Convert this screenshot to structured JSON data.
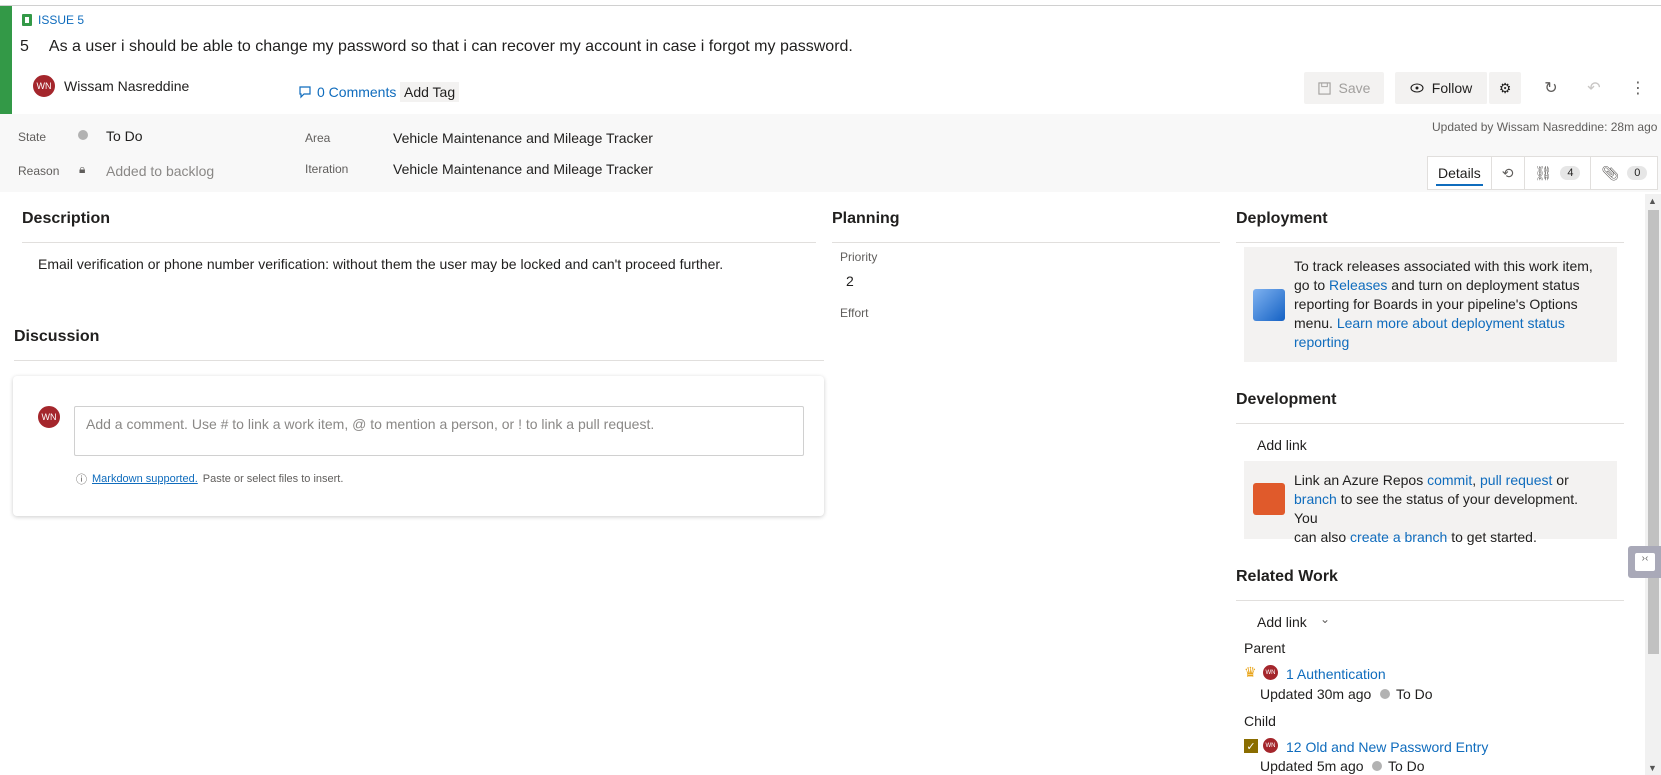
{
  "workitem": {
    "type_label": "ISSUE 5",
    "id": "5",
    "title": "As a user i should be able to change my password so that i can recover my account in case i forgot my password.",
    "author": "Wissam Nasreddine",
    "author_initials": "WN",
    "comments_label": "0 Comments",
    "add_tag_label": "Add Tag"
  },
  "toolbar": {
    "save_label": "Save",
    "follow_label": "Follow"
  },
  "fields": {
    "state_label": "State",
    "state_value": "To Do",
    "reason_label": "Reason",
    "reason_value": "Added to backlog",
    "area_label": "Area",
    "area_value": "Vehicle Maintenance and Mileage Tracker",
    "iteration_label": "Iteration",
    "iteration_value": "Vehicle Maintenance and Mileage Tracker",
    "updated_text": "Updated by Wissam Nasreddine: 28m ago"
  },
  "tabs": {
    "details_label": "Details",
    "links_count": "4",
    "attachments_count": "0"
  },
  "description": {
    "title": "Description",
    "text": "Email verification or phone number verification: without them the user may be locked and can't proceed further."
  },
  "discussion": {
    "title": "Discussion",
    "placeholder": "Add a comment. Use # to link a work item, @ to mention a person, or ! to link a pull request.",
    "markdown_link": "Markdown supported.",
    "markdown_hint": "Paste or select files to insert."
  },
  "planning": {
    "title": "Planning",
    "priority_label": "Priority",
    "priority_value": "2",
    "effort_label": "Effort"
  },
  "deployment": {
    "title": "Deployment",
    "line1": "To track releases associated with this work item,",
    "line2_pre": "go to ",
    "line2_link": "Releases",
    "line2_post": " and turn on deployment status",
    "line3": "reporting for Boards in your pipeline's Options",
    "line4_pre": "menu. ",
    "line4_link": "Learn more about deployment status",
    "line5_link": "reporting"
  },
  "development": {
    "title": "Development",
    "add_link": "Add link",
    "line1_pre": "Link an Azure Repos ",
    "line1_link1": "commit",
    "line1_sep": ", ",
    "line1_link2": "pull request",
    "line1_post": " or",
    "line2_link": "branch",
    "line2_post": " to see the status of your development. You",
    "line3_pre": "can also ",
    "line3_link": "create a branch",
    "line3_post": " to get started."
  },
  "related_work": {
    "title": "Related Work",
    "add_link": "Add link",
    "parent_label": "Parent",
    "parent_item": "1 Authentication",
    "parent_updated": "Updated 30m ago",
    "parent_state": "To Do",
    "child_label": "Child",
    "child_item": "12 Old and New Password Entry",
    "child_updated": "Updated 5m ago",
    "child_state": "To Do"
  },
  "colors": {
    "issue_green": "#339947",
    "link_blue": "#0f6cbd",
    "avatar_red": "#a4262c"
  }
}
